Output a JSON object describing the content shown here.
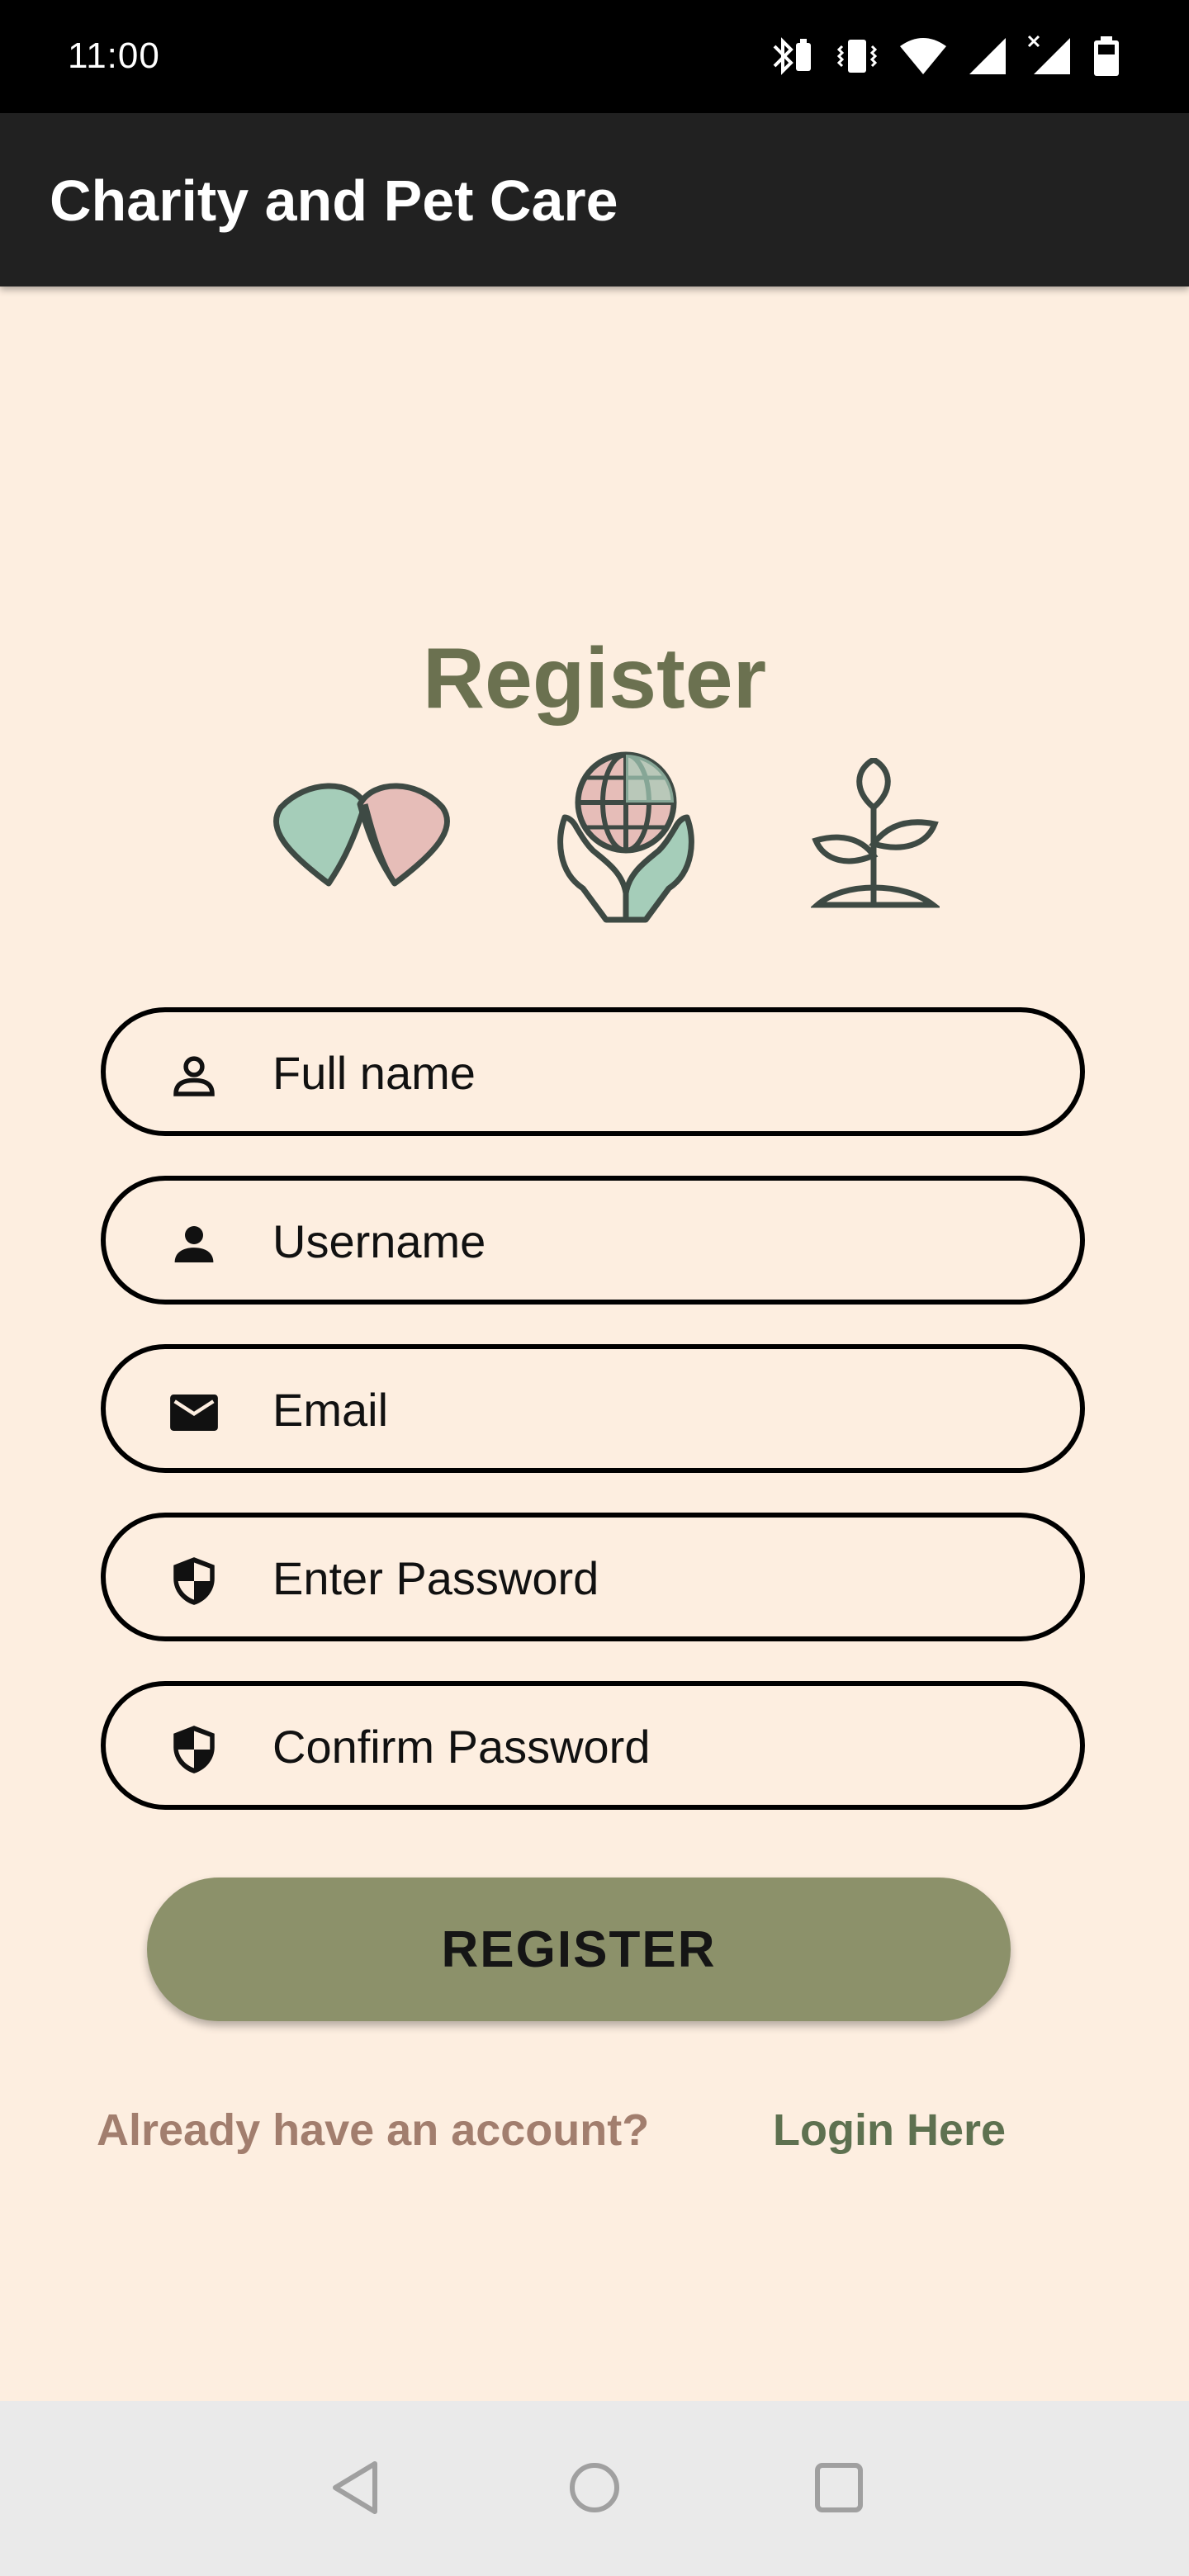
{
  "status_bar": {
    "time": "11:00",
    "icons": [
      "bluetooth-battery-icon",
      "vibrate-icon",
      "wifi-icon",
      "cell-signal-icon",
      "cell-signal-no-data-icon",
      "battery-icon"
    ]
  },
  "app_bar": {
    "title": "Charity and Pet Care"
  },
  "register": {
    "heading": "Register",
    "illustrations": [
      "hearts-icon",
      "globe-hands-icon",
      "plant-sprout-icon"
    ],
    "fields": [
      {
        "placeholder": "Full name",
        "icon": "person-outline-icon"
      },
      {
        "placeholder": "Username",
        "icon": "person-icon"
      },
      {
        "placeholder": "Email",
        "icon": "mail-icon"
      },
      {
        "placeholder": "Enter Password",
        "icon": "shield-icon"
      },
      {
        "placeholder": "Confirm Password",
        "icon": "shield-icon"
      }
    ],
    "button_label": "REGISTER",
    "already_text": "Already have an account?",
    "login_link": "Login Here"
  },
  "nav_bar": {
    "buttons": [
      "back-icon",
      "home-icon",
      "recents-icon"
    ]
  },
  "colors": {
    "background": "#FDEEE0",
    "app_bar": "#212121",
    "heading": "#6B7150",
    "button": "#8C916A",
    "already_text": "#A27E6E",
    "login_link": "#5E7150"
  }
}
